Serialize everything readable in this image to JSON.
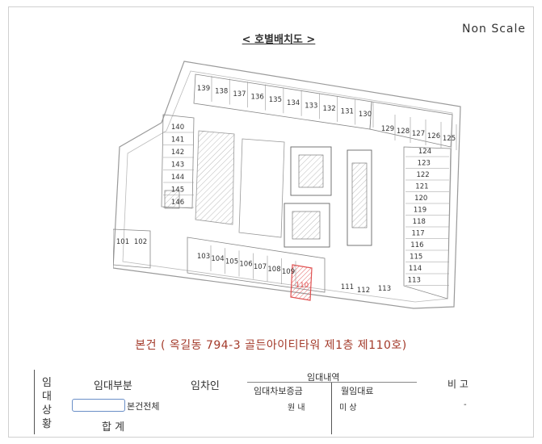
{
  "header": {
    "scale_note": "Non Scale",
    "plan_title": "< 호별배치도 >"
  },
  "floor_plan": {
    "units_top": [
      "139",
      "138",
      "137",
      "136",
      "135",
      "134",
      "133",
      "132",
      "131",
      "130"
    ],
    "units_top_right": [
      "129",
      "128",
      "127",
      "126",
      "125"
    ],
    "units_right": [
      "124",
      "123",
      "122",
      "121",
      "120",
      "119",
      "118",
      "117",
      "116",
      "115",
      "114",
      "113",
      "112",
      "111"
    ],
    "units_left": [
      "140",
      "141",
      "142",
      "143",
      "144",
      "145",
      "146"
    ],
    "units_bottom_left": [
      "101",
      "102"
    ],
    "units_bottom": [
      "103",
      "104",
      "105",
      "106",
      "107",
      "108",
      "109"
    ],
    "highlighted_unit": "110",
    "highlight_color": "#e05050"
  },
  "subject": "본건 ( 옥길동 794-3 골든아이티타워  제1층  제110호)",
  "lease": {
    "side_label": [
      "임",
      "대",
      "상",
      "황"
    ],
    "col_part": "임대부분",
    "col_lessee": "임차인",
    "col_detail": "임대내역",
    "col_deposit": "임대차보증금",
    "col_rent": "월임대료",
    "col_note": "비  고",
    "row_label": "본건전체",
    "deposit_value": "원  내",
    "rent_value": "미  상",
    "note_value": "-",
    "total_label": "합  계"
  }
}
